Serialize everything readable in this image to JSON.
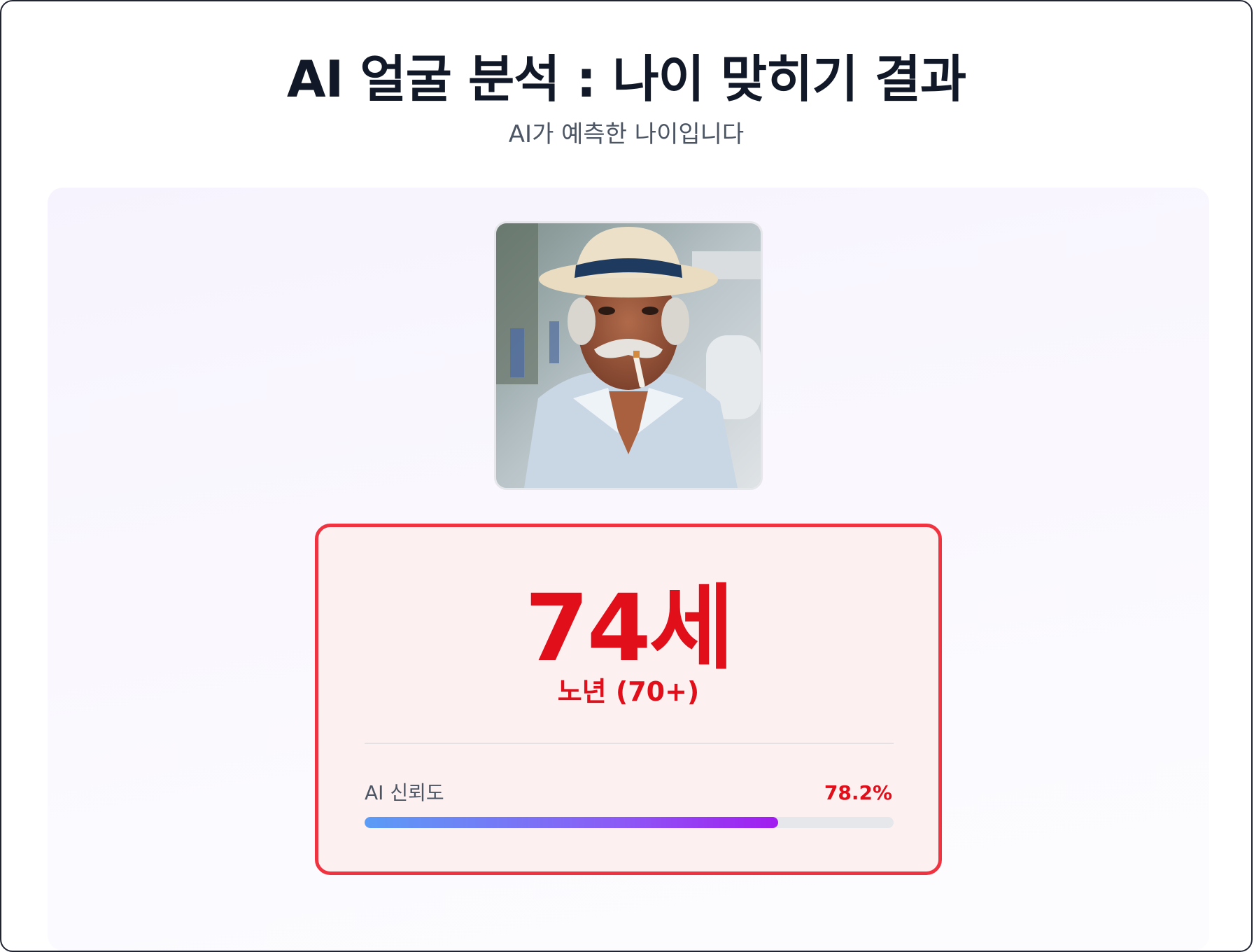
{
  "header": {
    "title": "AI 얼굴 분석 : 나이 맞히기 결과",
    "subtitle": "AI가 예측한 나이입니다"
  },
  "photo": {
    "icon": "face-photo"
  },
  "result": {
    "age_text": "74세",
    "age_group": "노년 (70+)",
    "confidence_label": "AI 신뢰도",
    "confidence_text": "78.2%",
    "confidence_value": 0.782
  },
  "colors": {
    "accent": "#e00f1a",
    "card_border": "#ef3340",
    "bar_start": "#5b9cf6",
    "bar_end": "#a21cf0"
  }
}
